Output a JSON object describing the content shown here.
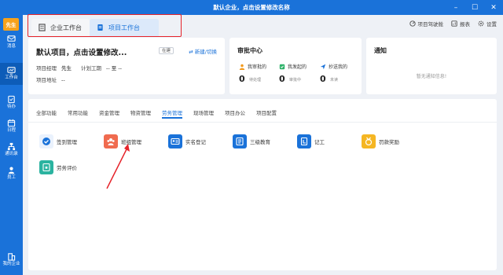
{
  "window": {
    "title": "默认企业，点击设置修改名称",
    "controls": [
      "–",
      "☐",
      "✕"
    ]
  },
  "sidebar": {
    "logo": "先生",
    "items": [
      {
        "label": "消息",
        "icon": "message-icon"
      },
      {
        "label": "工作台",
        "icon": "workbench-icon",
        "active": true
      },
      {
        "label": "待办",
        "icon": "todo-icon"
      },
      {
        "label": "日程",
        "icon": "calendar-icon"
      },
      {
        "label": "通讯录",
        "icon": "contacts-icon"
      },
      {
        "label": "员工",
        "icon": "staff-icon"
      },
      {
        "label": "我的企业",
        "icon": "enterprise-icon"
      }
    ]
  },
  "tabs": [
    {
      "label": "企业工作台",
      "icon": "building-icon"
    },
    {
      "label": "项目工作台",
      "icon": "document-icon",
      "active": true
    }
  ],
  "toolbar": {
    "cockpit": "项目驾驶舱",
    "report": "报表",
    "settings": "设置"
  },
  "project": {
    "title": "默认项目，点击设置修改...",
    "status": "在建",
    "switch_label": "新建/切换",
    "manager_label": "项目经理",
    "manager_value": "先生",
    "period_label": "计划工期",
    "period_value": "-- 至 --",
    "address_label": "项目地址",
    "address_value": "--"
  },
  "approval": {
    "title": "审批中心",
    "columns": [
      {
        "label": "我审批的",
        "count": "0",
        "sub": "待处理",
        "color": "#f39a1d"
      },
      {
        "label": "我发起的",
        "count": "0",
        "sub": "审批中",
        "color": "#2fb26a"
      },
      {
        "label": "抄送我的",
        "count": "0",
        "sub": "未读",
        "color": "#1a72d9"
      }
    ]
  },
  "notice": {
    "title": "通知",
    "empty": "暂无通知信息!"
  },
  "function_tabs": [
    "全部功能",
    "常用功能",
    "资金管理",
    "物资管理",
    "劳务管理",
    "现场管理",
    "项目办公",
    "项目配置"
  ],
  "active_function_tab": "劳务管理",
  "functions": [
    {
      "label": "签到管理",
      "color": "#eaf2fd",
      "icon": "checkin-icon"
    },
    {
      "label": "班组管理",
      "color": "#f06b4f",
      "icon": "team-icon"
    },
    {
      "label": "实名登记",
      "color": "#1a72d9",
      "icon": "id-card-icon"
    },
    {
      "label": "三级教育",
      "color": "#1a72d9",
      "icon": "education-icon"
    },
    {
      "label": "记工",
      "color": "#1a72d9",
      "icon": "worklog-icon"
    },
    {
      "label": "罚款奖励",
      "color": "#f5b623",
      "icon": "reward-icon"
    },
    {
      "label": "劳务评价",
      "color": "#2bb3a0",
      "icon": "evaluation-icon"
    }
  ]
}
